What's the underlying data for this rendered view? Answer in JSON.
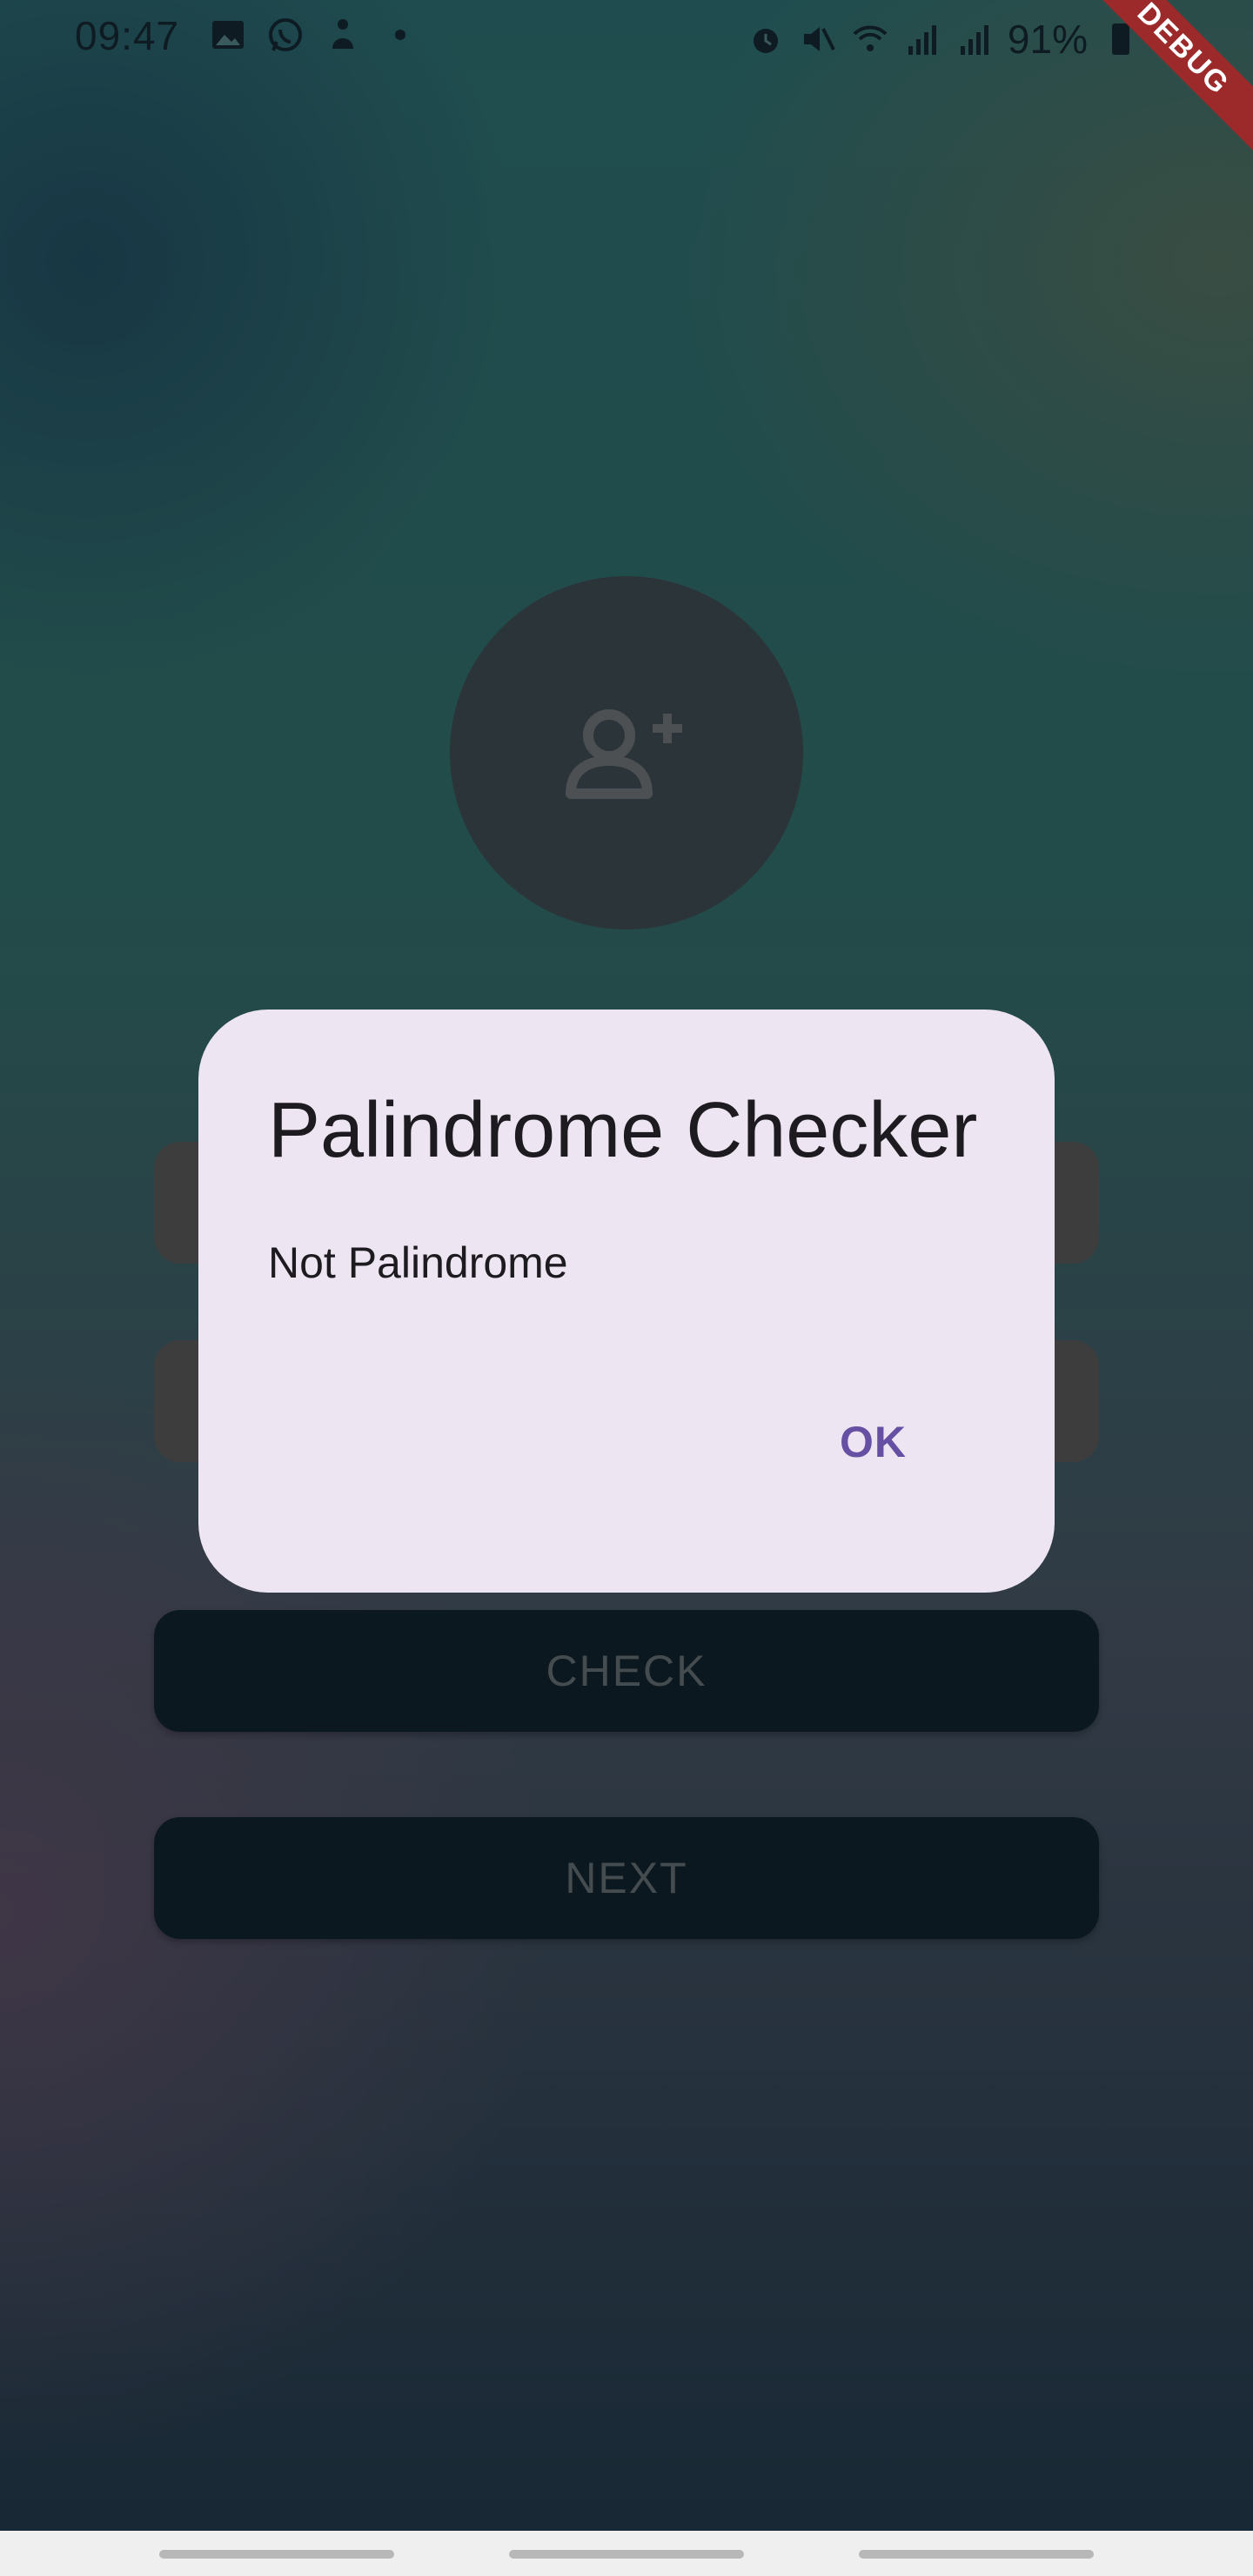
{
  "status_bar": {
    "time": "09:47",
    "battery": "91%",
    "left_icons": [
      "image-icon",
      "whatsapp-icon",
      "app-notification-icon",
      "dot-icon"
    ],
    "right_icons": [
      "alarm-icon",
      "mute-icon",
      "wifi-icon",
      "signal-icon",
      "signal-icon",
      "battery-icon"
    ]
  },
  "debug_banner": {
    "label": "DEBUG"
  },
  "background_form": {
    "avatar_icon": "person-add-icon",
    "check_label": "CHECK",
    "next_label": "NEXT"
  },
  "dialog": {
    "title": "Palindrome Checker",
    "message": "Not Palindrome",
    "ok_label": "OK"
  },
  "colors": {
    "dialog_bg": "#ede6f2",
    "accent": "#6650a4",
    "button_bg": "#172d39",
    "debug_banner": "#9c2a2a"
  }
}
